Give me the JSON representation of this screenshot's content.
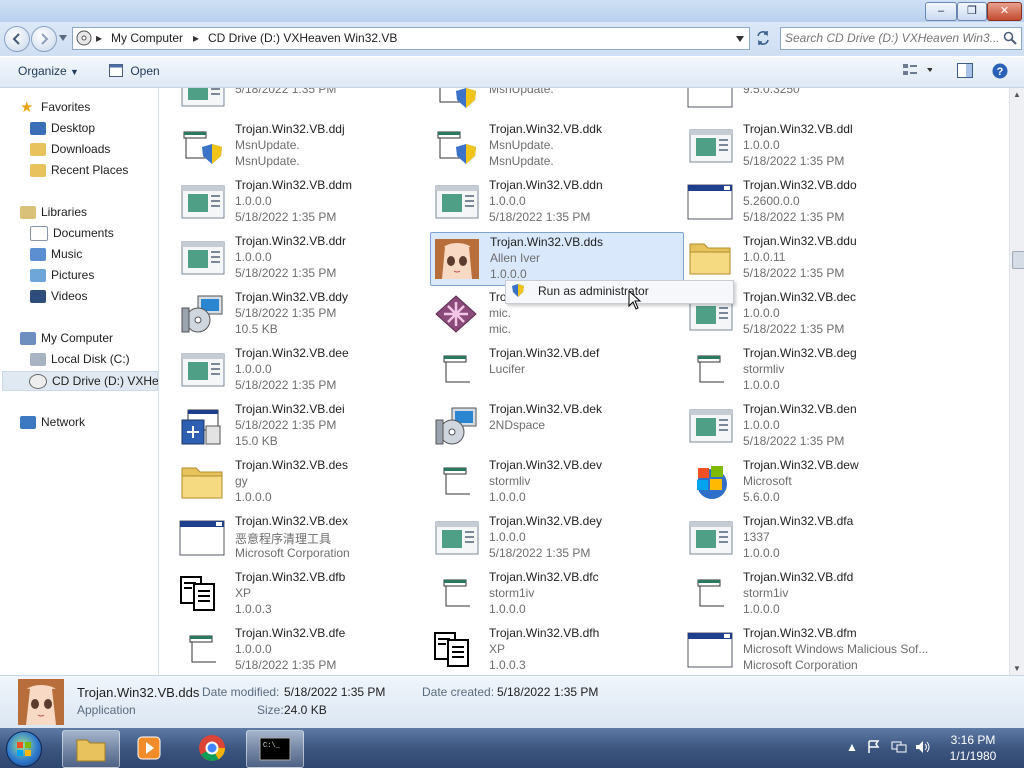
{
  "window": {
    "minimize_icon": "–",
    "maximize_icon": "❐",
    "close_icon": "✕"
  },
  "address": {
    "crumbs": [
      "My Computer",
      "CD Drive (D:) VXHeaven Win32.VB"
    ],
    "search_placeholder": "Search CD Drive (D:) VXHeaven Win3..."
  },
  "toolbar": {
    "organize_label": "Organize",
    "open_label": "Open"
  },
  "nav": {
    "favorites": "Favorites",
    "desktop": "Desktop",
    "downloads": "Downloads",
    "recent": "Recent Places",
    "libraries": "Libraries",
    "documents": "Documents",
    "music": "Music",
    "pictures": "Pictures",
    "videos": "Videos",
    "computer": "My Computer",
    "local_disk": "Local Disk (C:)",
    "cd_drive": "CD Drive (D:) VXHea",
    "network": "Network"
  },
  "files": [
    {
      "name": "",
      "l1": "5/18/2022 1:35 PM",
      "l2": "",
      "icon": "exe-window"
    },
    {
      "name": "",
      "l1": "MsnUpdate.",
      "l2": "",
      "icon": "setup-shield"
    },
    {
      "name": "",
      "l1": "9.5.0.3250",
      "l2": "",
      "icon": "exe-blank"
    },
    {
      "name": "Trojan.Win32.VB.ddj",
      "l1": "MsnUpdate.",
      "l2": "MsnUpdate.",
      "icon": "setup-shield"
    },
    {
      "name": "Trojan.Win32.VB.ddk",
      "l1": "MsnUpdate.",
      "l2": "MsnUpdate.",
      "icon": "setup-shield"
    },
    {
      "name": "Trojan.Win32.VB.ddl",
      "l1": "1.0.0.0",
      "l2": "5/18/2022 1:35 PM",
      "icon": "exe-window"
    },
    {
      "name": "Trojan.Win32.VB.ddm",
      "l1": "1.0.0.0",
      "l2": "5/18/2022 1:35 PM",
      "icon": "exe-window"
    },
    {
      "name": "Trojan.Win32.VB.ddn",
      "l1": "1.0.0.0",
      "l2": "5/18/2022 1:35 PM",
      "icon": "exe-window"
    },
    {
      "name": "Trojan.Win32.VB.ddo",
      "l1": "5.2600.0.0",
      "l2": "5/18/2022 1:35 PM",
      "icon": "exe-blank"
    },
    {
      "name": "Trojan.Win32.VB.ddr",
      "l1": "1.0.0.0",
      "l2": "5/18/2022 1:35 PM",
      "icon": "exe-window"
    },
    {
      "name": "Trojan.Win32.VB.dds",
      "l1": "Allen Iver",
      "l2": "1.0.0.0",
      "icon": "anime",
      "selected": true
    },
    {
      "name": "Trojan.Win32.VB.ddu",
      "l1": "1.0.0.11",
      "l2": "5/18/2022 1:35 PM",
      "icon": "folder"
    },
    {
      "name": "Trojan.Win32.VB.ddy",
      "l1": "5/18/2022 1:35 PM",
      "l2": "10.5 KB",
      "icon": "monitor-cd"
    },
    {
      "name": "Trojan.Win32.VB.ddz",
      "l1": "mic.",
      "l2": "mic.",
      "icon": "pink-star"
    },
    {
      "name": "Trojan.Win32.VB.dec",
      "l1": "1.0.0.0",
      "l2": "5/18/2022 1:35 PM",
      "icon": "exe-window"
    },
    {
      "name": "Trojan.Win32.VB.dee",
      "l1": "1.0.0.0",
      "l2": "5/18/2022 1:35 PM",
      "icon": "exe-window"
    },
    {
      "name": "Trojan.Win32.VB.def",
      "l1": "Lucifer",
      "l2": "",
      "icon": "setup"
    },
    {
      "name": "Trojan.Win32.VB.deg",
      "l1": "stormliv",
      "l2": "1.0.0.0",
      "icon": "setup"
    },
    {
      "name": "Trojan.Win32.VB.dei",
      "l1": "5/18/2022 1:35 PM",
      "l2": "15.0 KB",
      "icon": "installer"
    },
    {
      "name": "Trojan.Win32.VB.dek",
      "l1": "2NDspace",
      "l2": "",
      "icon": "monitor-cd"
    },
    {
      "name": "Trojan.Win32.VB.den",
      "l1": "1.0.0.0",
      "l2": "5/18/2022 1:35 PM",
      "icon": "exe-window"
    },
    {
      "name": "Trojan.Win32.VB.des",
      "l1": "gy",
      "l2": "1.0.0.0",
      "icon": "folder"
    },
    {
      "name": "Trojan.Win32.VB.dev",
      "l1": "stormliv",
      "l2": "1.0.0.0",
      "icon": "setup"
    },
    {
      "name": "Trojan.Win32.VB.dew",
      "l1": "Microsoft",
      "l2": "5.6.0.0",
      "icon": "windows-logo"
    },
    {
      "name": "Trojan.Win32.VB.dex",
      "l1": "恶意程序清理工具",
      "l2": "Microsoft Corporation",
      "icon": "exe-blank"
    },
    {
      "name": "Trojan.Win32.VB.dey",
      "l1": "1.0.0.0",
      "l2": "5/18/2022 1:35 PM",
      "icon": "exe-window"
    },
    {
      "name": "Trojan.Win32.VB.dfa",
      "l1": "1337",
      "l2": "1.0.0.0",
      "icon": "exe-window"
    },
    {
      "name": "Trojan.Win32.VB.dfb",
      "l1": "XP",
      "l2": "1.0.0.3",
      "icon": "docs"
    },
    {
      "name": "Trojan.Win32.VB.dfc",
      "l1": "storm1iv",
      "l2": "1.0.0.0",
      "icon": "setup"
    },
    {
      "name": "Trojan.Win32.VB.dfd",
      "l1": "storm1iv",
      "l2": "1.0.0.0",
      "icon": "setup"
    },
    {
      "name": "Trojan.Win32.VB.dfe",
      "l1": "1.0.0.0",
      "l2": "5/18/2022 1:35 PM",
      "icon": "setup"
    },
    {
      "name": "Trojan.Win32.VB.dfh",
      "l1": "XP",
      "l2": "1.0.0.3",
      "icon": "docs"
    },
    {
      "name": "Trojan.Win32.VB.dfm",
      "l1": "Microsoft Windows Malicious Sof...",
      "l2": "Microsoft Corporation",
      "icon": "exe-blank"
    }
  ],
  "context_menu": {
    "item": "Run as administrator"
  },
  "details": {
    "name": "Trojan.Win32.VB.dds",
    "type": "Application",
    "modified_label": "Date modified:",
    "modified_value": "5/18/2022 1:35 PM",
    "created_label": "Date created:",
    "created_value": "5/18/2022 1:35 PM",
    "size_label": "Size:",
    "size_value": "24.0 KB"
  },
  "taskbar": {
    "time": "3:16 PM",
    "date": "1/1/1980"
  }
}
